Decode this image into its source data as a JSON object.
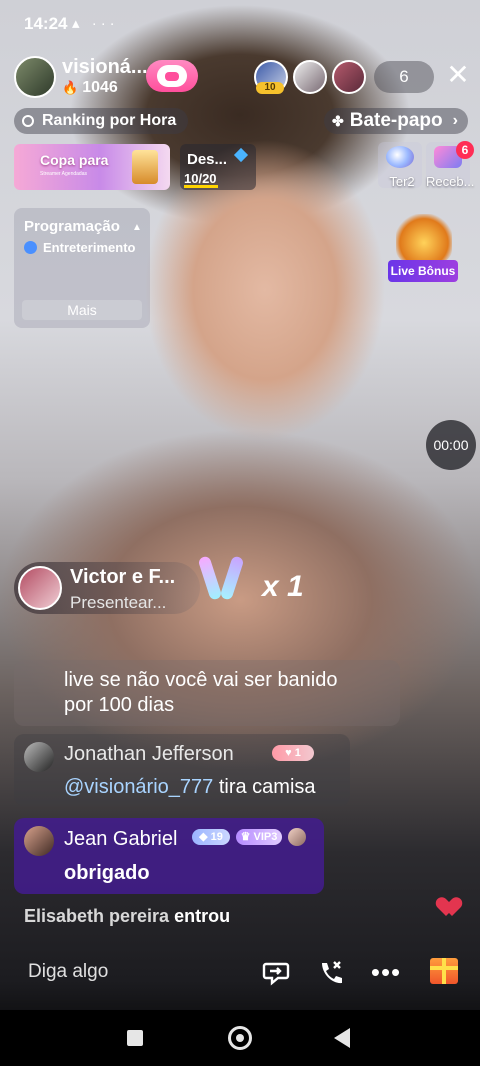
{
  "status_bar": {
    "time": "14:24",
    "icons": "▴ ···"
  },
  "host": {
    "name": "visioná...",
    "likes": "1046"
  },
  "viewers": {
    "top_level": "10",
    "count": "6"
  },
  "top_bar": {
    "ranking_label": "Ranking por Hora",
    "chat_label": "Bate-papo",
    "chat_chevron": "›"
  },
  "event": {
    "title": "Copa para",
    "subtitle": "Streamer Agendadas"
  },
  "challenge": {
    "title": "Des...",
    "progress": "10/20"
  },
  "side_buttons": {
    "tier_label": "Ter2",
    "received_label": "Receb...",
    "received_badge": "6"
  },
  "program": {
    "title": "Programação",
    "category": "Entreterimento",
    "more_label": "Mais"
  },
  "bonus": {
    "label": "Live Bônus"
  },
  "timer": {
    "value": "00:00"
  },
  "gift_banner": {
    "sender": "Victor e F...",
    "action": "Presentear...",
    "multiplier": "x 1"
  },
  "chat": {
    "messages": [
      {
        "text_line1": "live se não você vai ser banido",
        "text_line2": "por 100 dias"
      },
      {
        "name": "Jonathan Jefferson",
        "level": "1",
        "mention": "@visionário_777",
        "text": "tira camisa"
      },
      {
        "name": "Jean Gabriel",
        "level": "19",
        "vip": "VIP3",
        "text": "obrigado"
      }
    ]
  },
  "join": {
    "user": "Elisabeth pereira",
    "action": "entrou"
  },
  "input": {
    "placeholder": "Diga algo"
  },
  "colors": {
    "accent_purple": "#421c8c",
    "follow_pink": "#ff4f9c",
    "badge_red": "#ff2d55"
  }
}
